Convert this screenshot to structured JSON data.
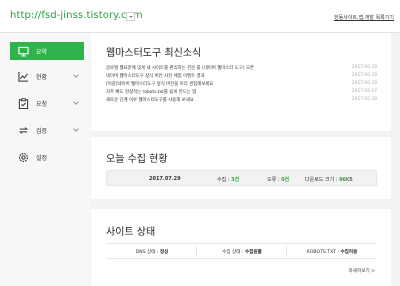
{
  "header": {
    "site_url": "http://fsd-jinss.tistory.com",
    "top_right_link": "한동사이트,앱,개발 목록기기"
  },
  "sidebar": {
    "items": [
      {
        "label": "요약",
        "icon": "monitor-icon",
        "active": true
      },
      {
        "label": "현황",
        "icon": "line-chart-icon",
        "active": false
      },
      {
        "label": "요청",
        "icon": "clipboard-icon",
        "active": false
      },
      {
        "label": "검증",
        "icon": "refresh-icon",
        "active": false
      },
      {
        "label": "설정",
        "icon": "gear-icon",
        "active": false
      }
    ]
  },
  "news": {
    "title": "웹마스터도구 최신소식",
    "items": [
      {
        "text": "글로벌 웹표준에 맞게 새 사이트를 편리하는 전문 를 (네이버 웹마스터 도구) 오픈",
        "date": "2017.06.28"
      },
      {
        "text": "네이버 웹마스터도구 정식 버전 사전 체험 이벤트 결과",
        "date": "2017.06.28"
      },
      {
        "text": "[이감]네이버 웹마스터도구 정식 버전을 미리 경험해보세요",
        "date": "2017.06.28"
      },
      {
        "text": "자주 빠도 현실적는 robots.txt를 쉽게 만드는 법",
        "date": "2017.05.07"
      },
      {
        "text": "새로운 단계 이루 웹마스터도구를 사용해 보세요",
        "date": "2017.05.28"
      }
    ]
  },
  "today_stats": {
    "title": "오늘 수집 현황",
    "date": "2017.07.29",
    "collect_label": "수집 :",
    "collect_value": "3건",
    "error_label": "오류 :",
    "error_value": "0건",
    "download_label": "다운로드 크기 :",
    "download_value": "96",
    "download_unit": "KB"
  },
  "site_status": {
    "title": "사이트 상태",
    "dns_label": "DNS 상태 : ",
    "dns_value": "정상",
    "collect_label": "수집 상태 : ",
    "collect_value": "수집원활",
    "robots_label": "ROBOTS.TXT : ",
    "robots_value": "수집허용",
    "more_link": "자세히보기 >"
  }
}
